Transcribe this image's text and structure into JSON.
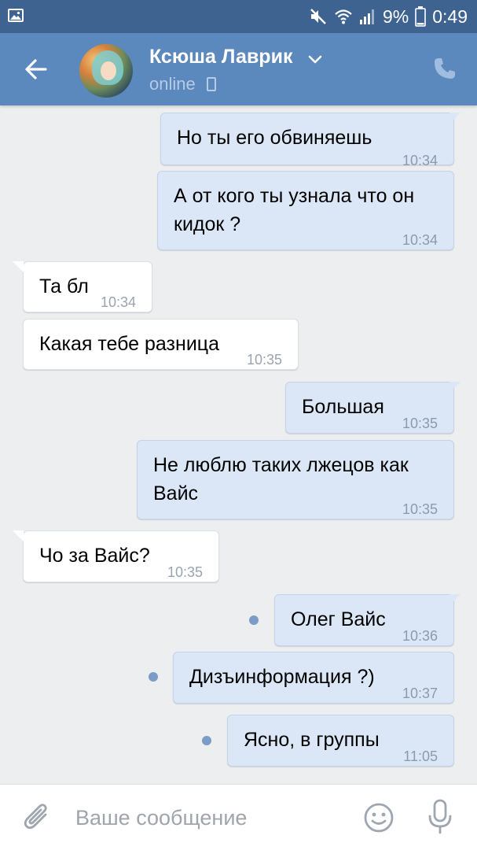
{
  "status_bar": {
    "battery": "9%",
    "time": "0:49"
  },
  "header": {
    "contact_name": "Ксюша Лаврик",
    "status": "online"
  },
  "messages": [
    {
      "dir": "out",
      "text": "Но ты его обвиняешь",
      "time": "10:34"
    },
    {
      "dir": "out",
      "text": "А от кого ты узнала что он\nкидок ?",
      "time": "10:34"
    },
    {
      "dir": "in",
      "text": "Та бл",
      "time": "10:34"
    },
    {
      "dir": "in",
      "text": "Какая тебе разница",
      "time": "10:35"
    },
    {
      "dir": "out",
      "text": "Большая",
      "time": "10:35"
    },
    {
      "dir": "out",
      "text": "Не люблю таких лжецов как\nВайс",
      "time": "10:35"
    },
    {
      "dir": "in",
      "text": "Чо за Вайс?",
      "time": "10:35"
    },
    {
      "dir": "out",
      "text": "Олег Вайс",
      "time": "10:36",
      "unread": true
    },
    {
      "dir": "out",
      "text": "Дизъинформация ?)",
      "time": "10:37",
      "unread": true
    },
    {
      "dir": "out",
      "text": "Ясно, в группы",
      "time": "11:05",
      "unread": true
    }
  ],
  "composer": {
    "placeholder": "Ваше сообщение"
  },
  "icons": {
    "back": "arrow-left-icon",
    "call": "phone-icon",
    "attach": "paperclip-icon",
    "emoji": "smiley-icon",
    "mic": "microphone-icon",
    "device": "mobile-device-icon"
  },
  "colors": {
    "status_bar": "#3f6391",
    "header": "#5b88bd",
    "outgoing_bubble": "#dbe7f6",
    "incoming_bubble": "#ffffff",
    "chat_background": "#edeef0",
    "unread_dot": "#7a9cc6"
  }
}
